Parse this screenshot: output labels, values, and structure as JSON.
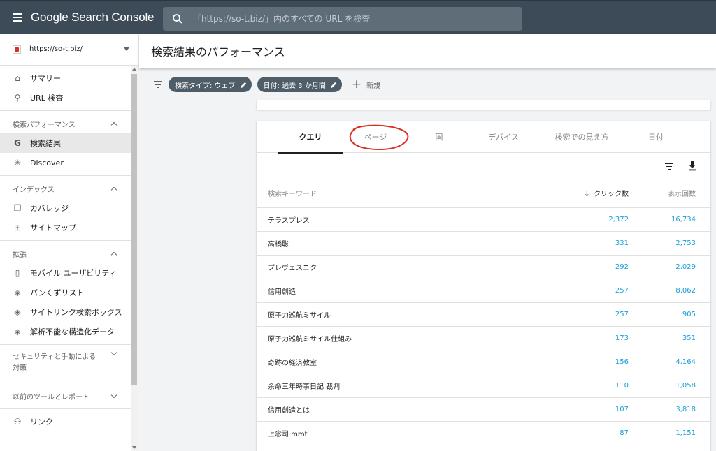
{
  "app": {
    "brand": "Google Search Console"
  },
  "search": {
    "placeholder": "「https://so-t.biz/」内のすべての URL を検査"
  },
  "sidebar": {
    "property_url": "https://so-t.biz/",
    "top_items": [
      {
        "label": "サマリー",
        "icon": "home-icon"
      },
      {
        "label": "URL 検査",
        "icon": "search-icon"
      }
    ],
    "sections": [
      {
        "title": "検索パフォーマンス",
        "items": [
          {
            "label": "検索結果",
            "icon": "google-g-icon",
            "active": true
          },
          {
            "label": "Discover",
            "icon": "asterisk-icon"
          }
        ]
      },
      {
        "title": "インデックス",
        "items": [
          {
            "label": "カバレッジ",
            "icon": "copy-icon"
          },
          {
            "label": "サイトマップ",
            "icon": "sitemap-icon"
          }
        ]
      },
      {
        "title": "拡張",
        "items": [
          {
            "label": "モバイル ユーザビリティ",
            "icon": "phone-icon"
          },
          {
            "label": "パンくずリスト",
            "icon": "layers-icon"
          },
          {
            "label": "サイトリンク検索ボックス",
            "icon": "layers-icon"
          },
          {
            "label": "解析不能な構造化データ",
            "icon": "layers-icon"
          }
        ]
      }
    ],
    "collapsed_sections": [
      {
        "title_line1": "セキュリティと手動による",
        "title_line2": "対策"
      },
      {
        "title_line1": "以前のツールとレポート"
      }
    ],
    "bottom_item": {
      "label": "リンク",
      "icon": "links-icon"
    }
  },
  "page": {
    "title": "検索結果のパフォーマンス"
  },
  "filters": {
    "chips": [
      "検索タイプ: ウェブ",
      "日付: 過去 3 か月間"
    ],
    "new_label": "新規"
  },
  "tabs": [
    "クエリ",
    "ページ",
    "国",
    "デバイス",
    "検索での見え方",
    "日付"
  ],
  "active_tab": "クエリ",
  "annotation_color": "#d93025",
  "table": {
    "headers": {
      "query": "検索キーワード",
      "clicks": "クリック数",
      "impressions": "表示回数"
    },
    "sort_indicator": "↓",
    "rows": [
      {
        "query": "テラスプレス",
        "clicks": "2,372",
        "impressions": "16,734"
      },
      {
        "query": "高橋聡",
        "clicks": "331",
        "impressions": "2,753"
      },
      {
        "query": "プレヴェスニク",
        "clicks": "292",
        "impressions": "2,029"
      },
      {
        "query": "信用創造",
        "clicks": "257",
        "impressions": "8,062"
      },
      {
        "query": "原子力巡航ミサイル",
        "clicks": "257",
        "impressions": "905"
      },
      {
        "query": "原子力巡航ミサイル仕組み",
        "clicks": "173",
        "impressions": "351"
      },
      {
        "query": "奇跡の経済教室",
        "clicks": "156",
        "impressions": "4,164"
      },
      {
        "query": "余命三年時事日記 裁判",
        "clicks": "110",
        "impressions": "1,058"
      },
      {
        "query": "信用創造とは",
        "clicks": "107",
        "impressions": "3,818"
      },
      {
        "query": "上念司 mmt",
        "clicks": "87",
        "impressions": "1,151"
      }
    ]
  },
  "colors": {
    "topbar": "#3c4b57",
    "chip": "#4e5d68",
    "link_number": "#1a9fd8"
  }
}
